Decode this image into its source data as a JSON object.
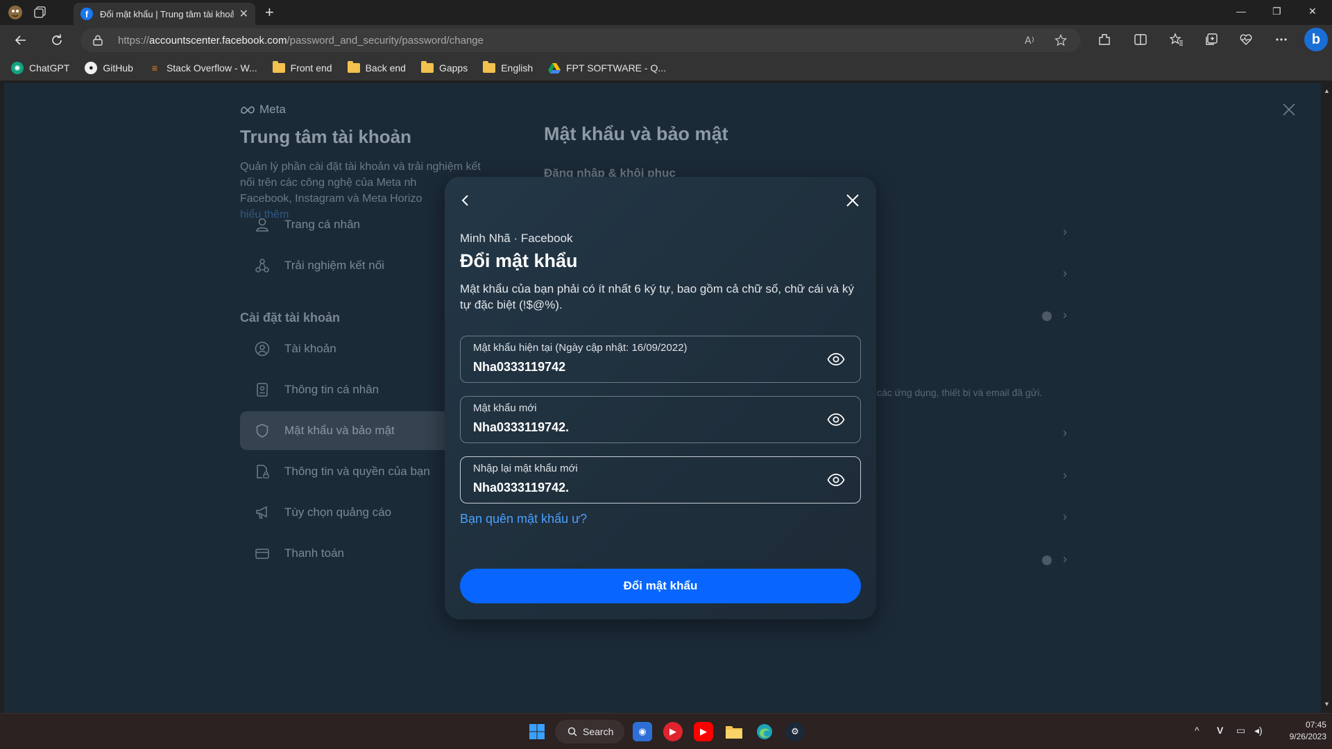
{
  "browser": {
    "tab_title": "Đổi mật khẩu | Trung tâm tài khoản",
    "url_scheme": "https://",
    "url_domain": "accountscenter.facebook.com",
    "url_path": "/password_and_security/password/change",
    "bookmarks": [
      {
        "label": "ChatGPT",
        "icon": "chatgpt-icon"
      },
      {
        "label": "GitHub",
        "icon": "github-icon"
      },
      {
        "label": "Stack Overflow - W...",
        "icon": "stackoverflow-icon"
      },
      {
        "label": "Front end",
        "icon": "folder-icon"
      },
      {
        "label": "Back end",
        "icon": "folder-icon"
      },
      {
        "label": "Gapps",
        "icon": "folder-icon"
      },
      {
        "label": "English",
        "icon": "folder-icon"
      },
      {
        "label": "FPT SOFTWARE - Q...",
        "icon": "google-drive-icon"
      }
    ]
  },
  "accounts_center": {
    "brand": "Meta",
    "title": "Trung tâm tài khoản",
    "description": "Quản lý phần cài đặt tài khoản và trải nghiệm kết nối trên các công nghệ của Meta nh",
    "description_2": "Facebook, Instagram và Meta Horizo",
    "learn_more": "hiểu thêm",
    "menu_top": [
      {
        "label": "Trang cá nhân",
        "icon": "person-icon"
      },
      {
        "label": "Trải nghiệm kết nối",
        "icon": "connected-icon"
      }
    ],
    "settings_title": "Cài đặt tài khoản",
    "menu_settings": [
      {
        "label": "Tài khoản",
        "icon": "account-circle-icon"
      },
      {
        "label": "Thông tin cá nhân",
        "icon": "id-card-icon"
      },
      {
        "label": "Mật khẩu và bảo mật",
        "icon": "shield-icon",
        "active": true
      },
      {
        "label": "Thông tin và quyền của bạn",
        "icon": "document-lock-icon"
      },
      {
        "label": "Tùy chọn quảng cáo",
        "icon": "megaphone-icon"
      },
      {
        "label": "Thanh toán",
        "icon": "credit-card-icon"
      }
    ],
    "right_title": "Mật khẩu và bảo mật",
    "right_subtitle": "Đăng nhập & khôi phục",
    "right_note": "các ứng dụng, thiết bị và email đã gửi."
  },
  "modal": {
    "account_line": "Minh Nhã · Facebook",
    "title": "Đổi mật khẩu",
    "description": "Mật khẩu của bạn phải có ít nhất 6 ký tự, bao gồm cả chữ số, chữ cái và ký tự đặc biệt (!$@%).",
    "fields": [
      {
        "label": "Mật khẩu hiện tại (Ngày cập nhật: 16/09/2022)",
        "value": "Nha0333119742"
      },
      {
        "label": "Mật khẩu mới",
        "value": "Nha0333119742."
      },
      {
        "label": "Nhập lại mật khẩu mới",
        "value": "Nha0333119742."
      }
    ],
    "forgot_link": "Bạn quên mật khẩu ư?",
    "submit_label": "Đổi mật khẩu"
  },
  "taskbar": {
    "search_label": "Search",
    "time": "07:45",
    "date": "9/26/2023"
  },
  "colors": {
    "accent": "#0866ff",
    "link": "#4aa0ff",
    "modal_bg": "#1f2f3c",
    "overlay_page": "#1b2a37"
  }
}
